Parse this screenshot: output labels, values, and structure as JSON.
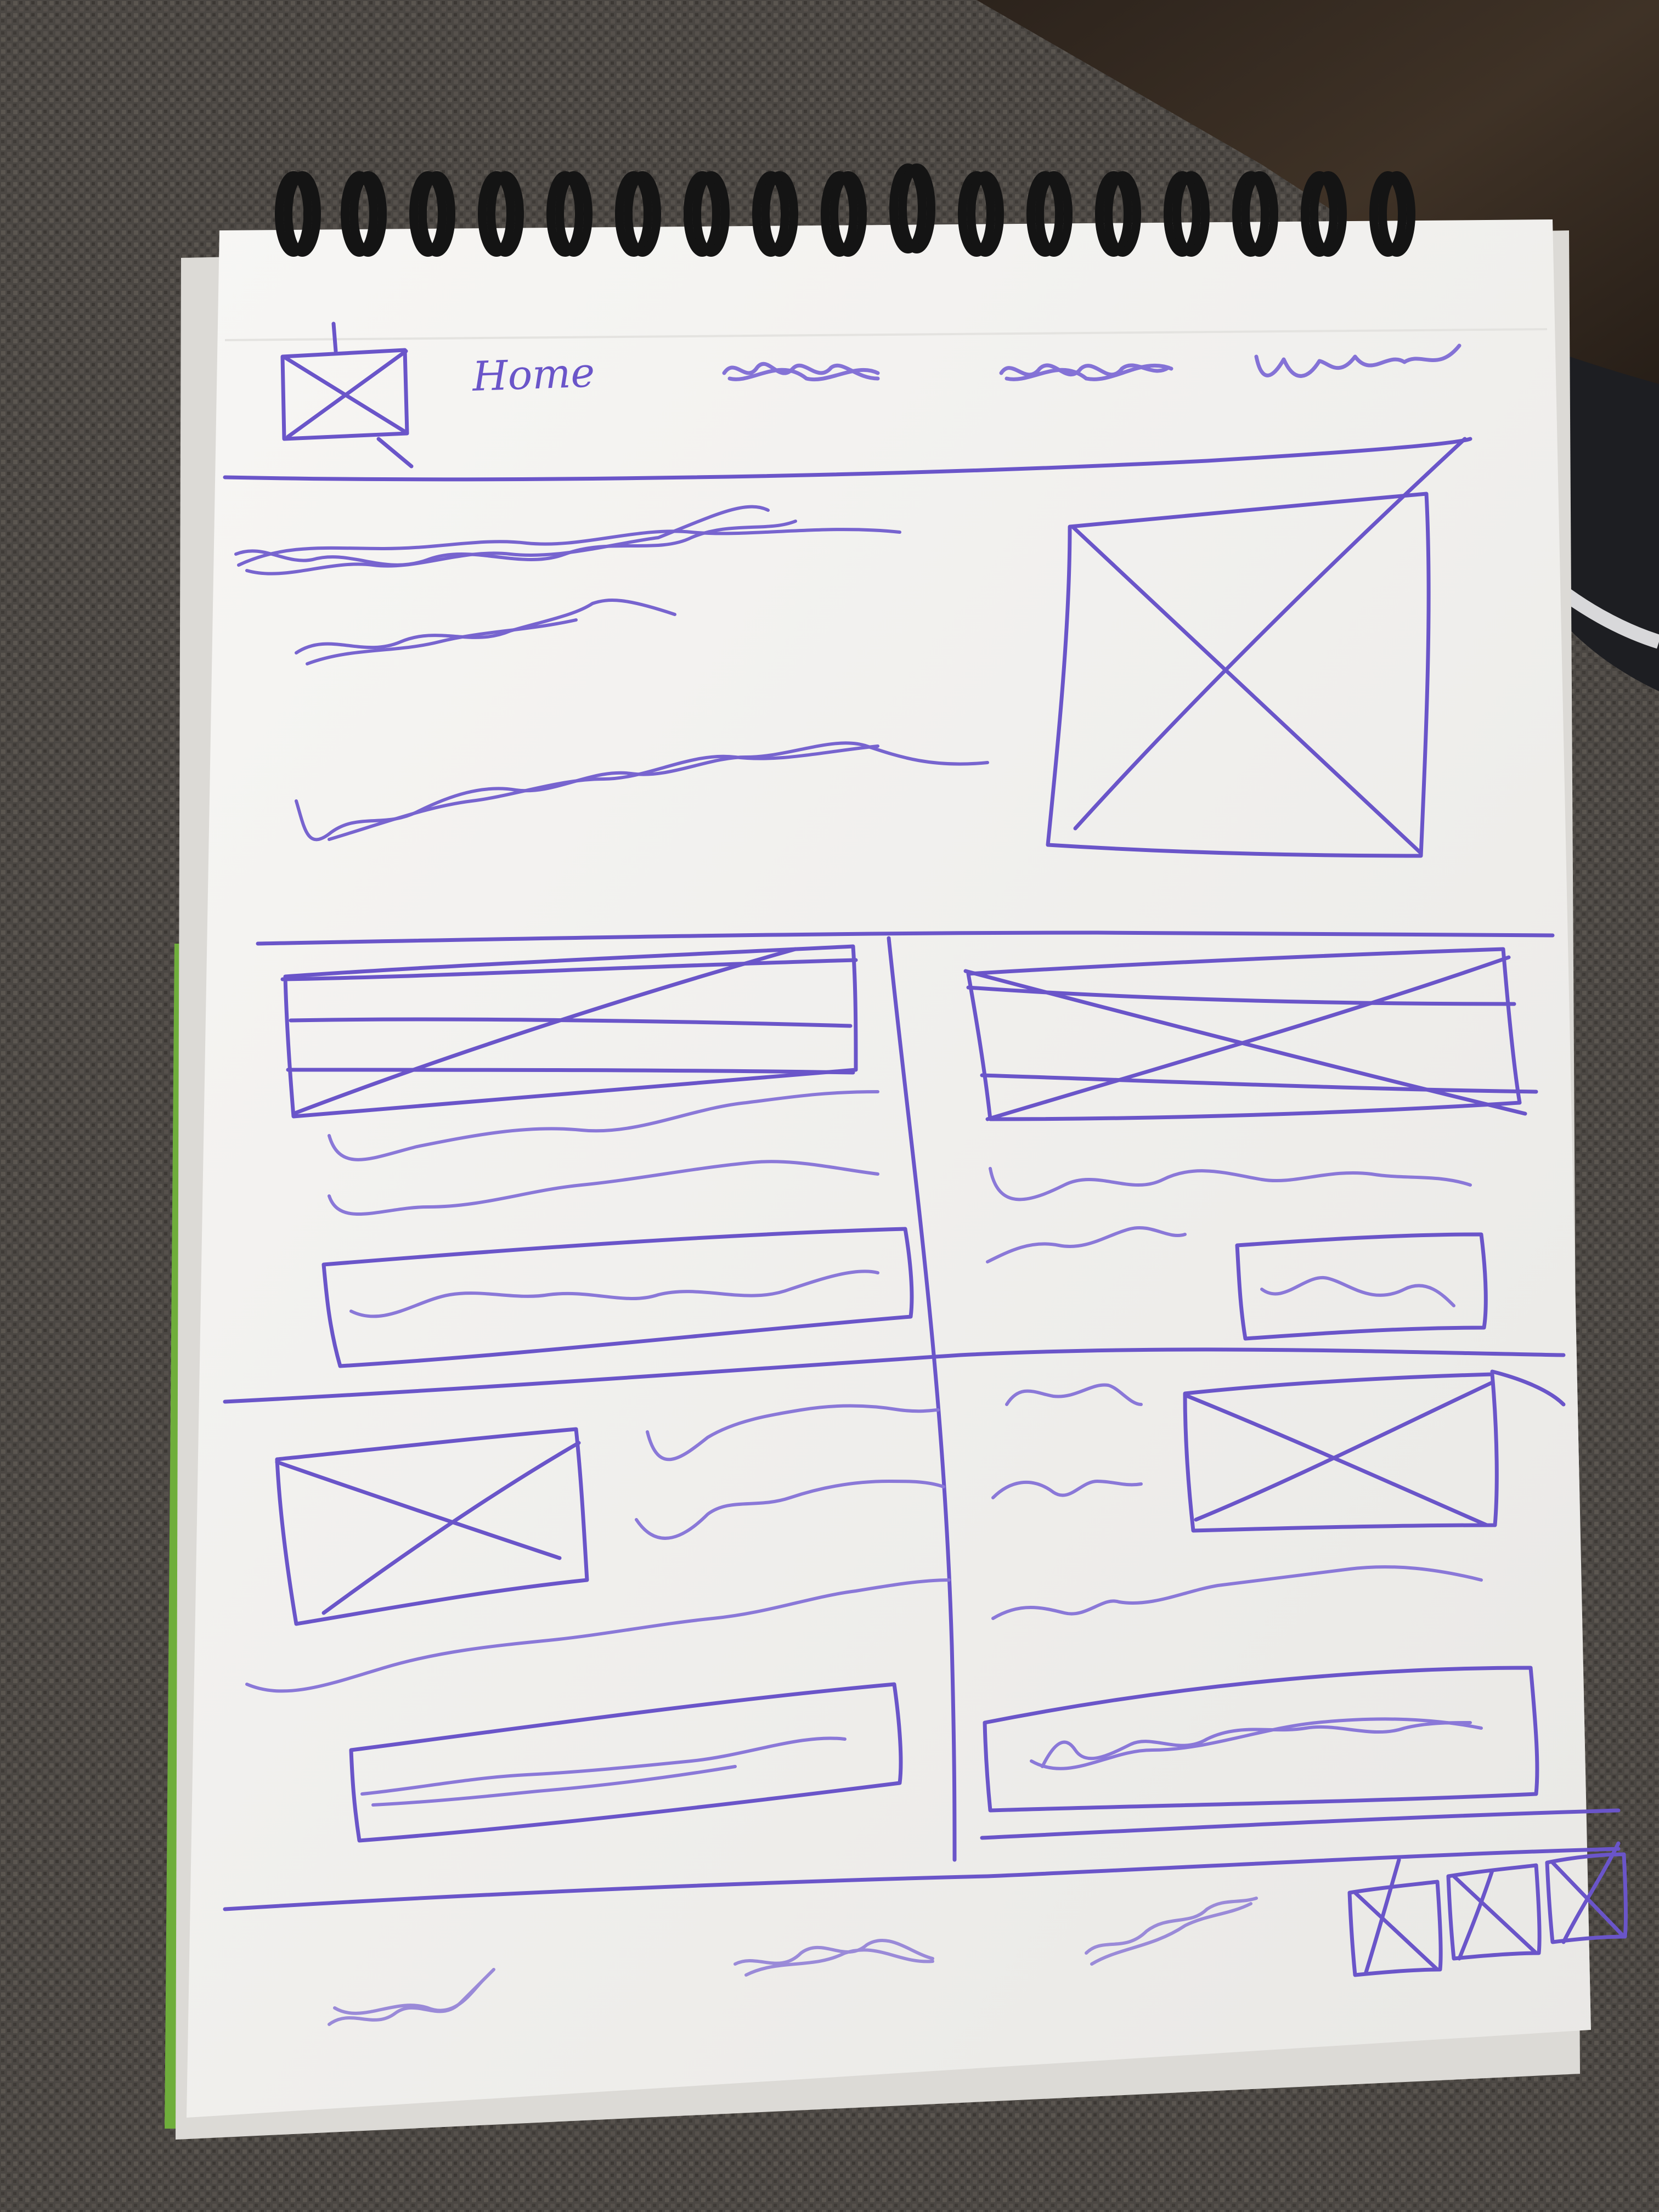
{
  "sketch": {
    "nav_home_label": "Home"
  },
  "colors": {
    "pencil": "#6a55c9",
    "pencil_light": "#9a8ad8",
    "paper": "#f4f3f1",
    "fabric": "#4a4642",
    "ring": "#141414"
  }
}
